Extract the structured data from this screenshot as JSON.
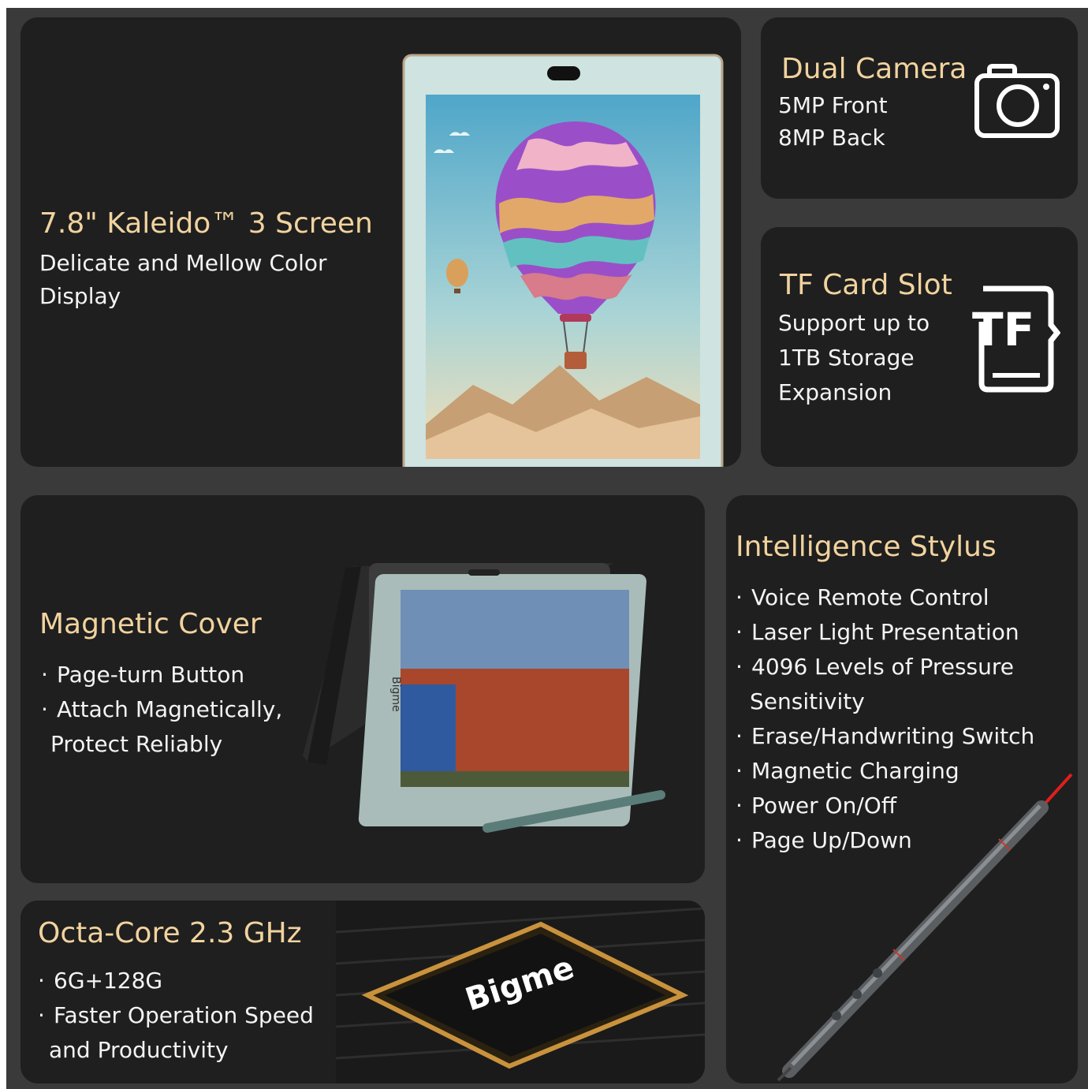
{
  "colors": {
    "background": "#3a3a3a",
    "card": "#1f1f1f",
    "title": "#f1d39e",
    "text": "#f4f4f4",
    "laser": "#e01e1e"
  },
  "screen": {
    "title": "7.8\" Kaleido™ 3 Screen",
    "lines": [
      "Delicate and Mellow Color",
      "Display"
    ]
  },
  "camera": {
    "title": "Dual Camera",
    "lines": [
      "5MP Front",
      "8MP Back"
    ],
    "icon": "camera-icon"
  },
  "tf_card": {
    "title": "TF Card Slot",
    "lines": [
      "Support up to",
      "1TB Storage",
      "Expansion"
    ],
    "icon": "tf-card-icon",
    "icon_label": "TF"
  },
  "cover": {
    "title": "Magnetic Cover",
    "items": [
      "Page-turn Button",
      "Attach Magnetically,"
    ],
    "continuation": "Protect Reliably",
    "device_brand": "Bigme"
  },
  "stylus": {
    "title": "Intelligence Stylus",
    "items": [
      "Voice Remote Control",
      "Laser Light Presentation",
      "4096 Levels of Pressure"
    ],
    "continuation": "Sensitivity",
    "items_after": [
      "Erase/Handwriting Switch",
      "Magnetic Charging",
      "Power On/Off",
      "Page Up/Down"
    ]
  },
  "cpu": {
    "title": "Octa-Core 2.3 GHz",
    "items": [
      "6G+128G",
      "Faster Operation Speed"
    ],
    "continuation": "and Productivity",
    "chip_brand": "Bigme"
  },
  "bullet_char": "·"
}
